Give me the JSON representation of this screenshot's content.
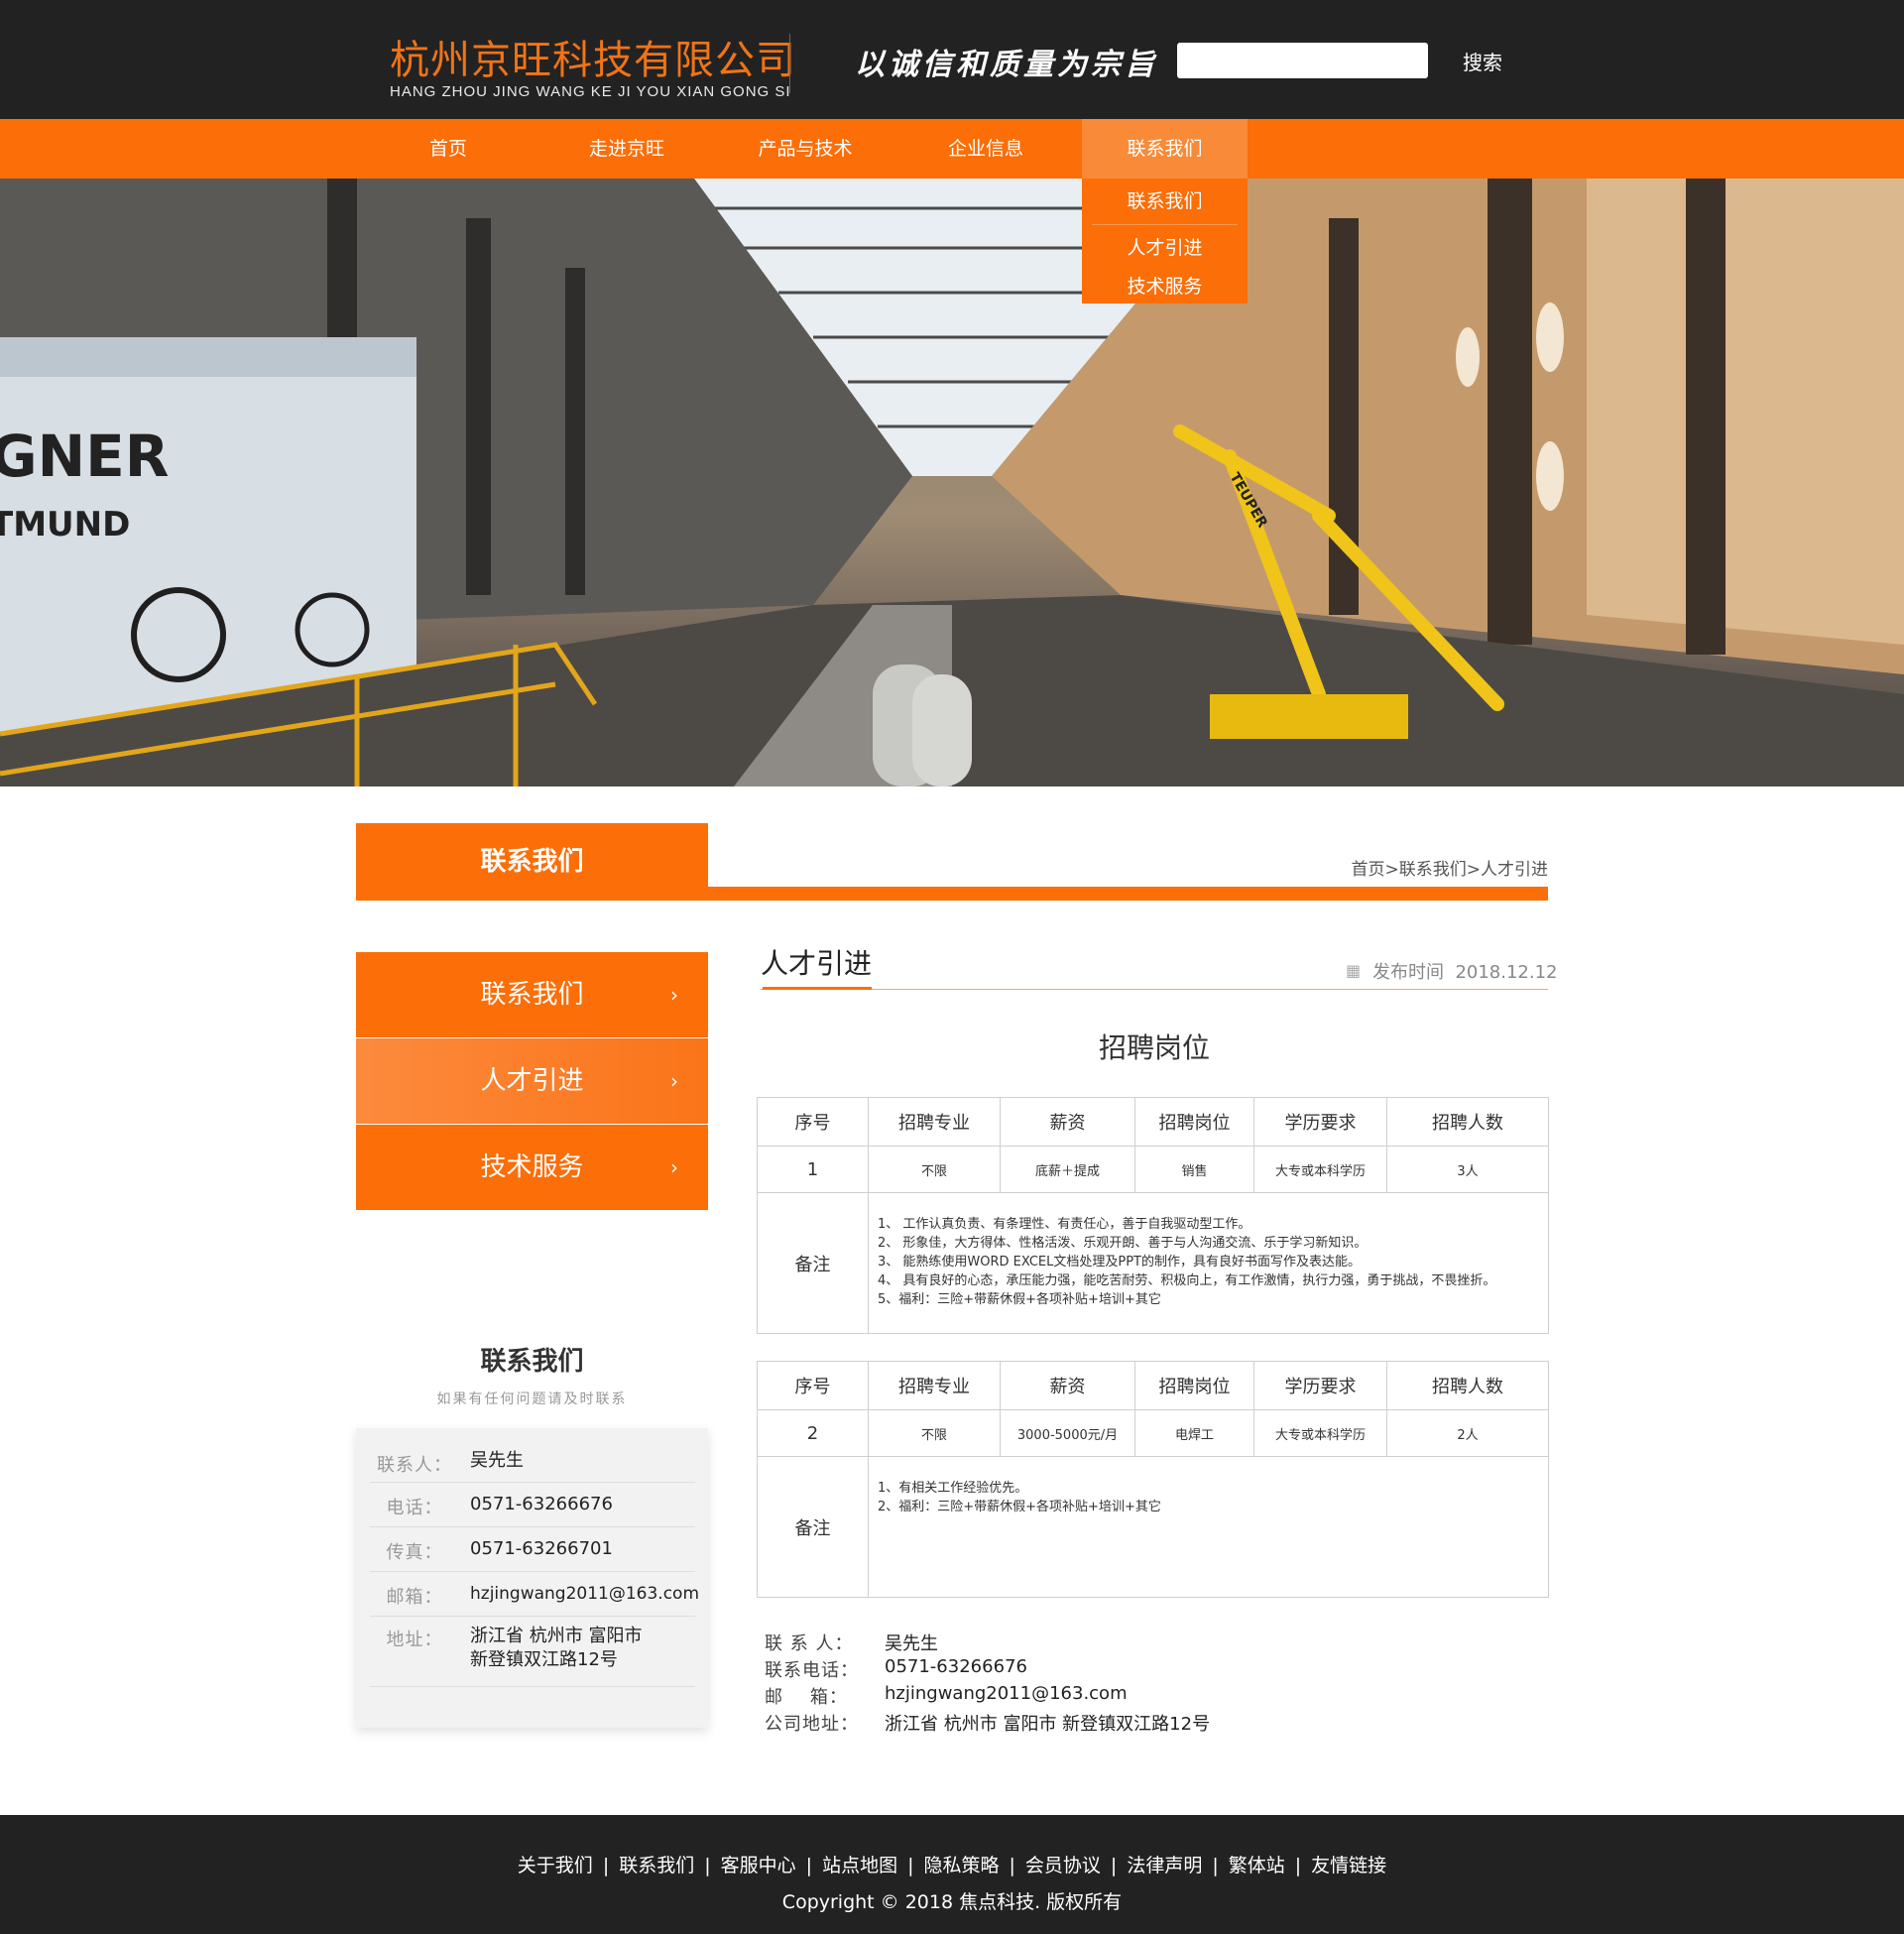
{
  "header": {
    "company_name": "杭州京旺科技有限公司",
    "company_pinyin": "HANG ZHOU JING WANG KE JI YOU XIAN GONG SI",
    "slogan": "以诚信和质量为宗旨",
    "search_placeholder": "",
    "search_label": "搜索"
  },
  "nav": {
    "items": [
      "首页",
      "走进京旺",
      "产品与技术",
      "企业信息",
      "联系我们"
    ],
    "dropdown": [
      "联系我们",
      "人才引进",
      "技术服务"
    ]
  },
  "banner": {
    "text_line1": "GNER",
    "text_line2": "TMUND",
    "crane_label": "TEUPER",
    "active_slide": 1,
    "slide_count": 2
  },
  "section": {
    "title": "联系我们",
    "breadcrumb": [
      "首页",
      "联系我们",
      "人才引进"
    ],
    "breadcrumb_sep": ">"
  },
  "sidebar": {
    "menu": [
      "联系我们",
      "人才引进",
      "技术服务"
    ],
    "arrow": "›",
    "contact_title": "联系我们",
    "contact_subtitle": "如果有任何问题请及时联系",
    "contact": [
      {
        "label": "联系人：",
        "value": "吴先生"
      },
      {
        "label": "电话：",
        "value": "0571-63266676"
      },
      {
        "label": "传真：",
        "value": "0571-63266701"
      },
      {
        "label": "邮箱：",
        "value": "hzjingwang2011@163.com"
      },
      {
        "label": "地址：",
        "value_line1": "浙江省 杭州市 富阳市",
        "value_line2": "新登镇双江路12号"
      }
    ]
  },
  "article": {
    "title": "人才引进",
    "date_label": "发布时间",
    "date": "2018.12.12",
    "heading": "招聘岗位",
    "columns": [
      "序号",
      "招聘专业",
      "薪资",
      "招聘岗位",
      "学历要求",
      "招聘人数"
    ],
    "notes_label": "备注",
    "jobs": [
      {
        "no": "1",
        "major": "不限",
        "salary": "底薪＋提成",
        "position": "销售",
        "education": "大专或本科学历",
        "count": "3人",
        "notes": [
          "1、 工作认真负责、有条理性、有责任心，善于自我驱动型工作。",
          "2、 形象佳，大方得体、性格活泼、乐观开朗、善于与人沟通交流、乐于学习新知识。",
          "3、 能熟练使用WORD EXCEL文档处理及PPT的制作，具有良好书面写作及表达能。",
          "4、 具有良好的心态，承压能力强，能吃苦耐劳、积极向上，有工作激情，执行力强，勇于挑战，不畏挫折。",
          "5、福利：三险+带薪休假+各项补贴+培训+其它"
        ]
      },
      {
        "no": "2",
        "major": "不限",
        "salary": "3000-5000元/月",
        "position": "电焊工",
        "education": "大专或本科学历",
        "count": "2人",
        "notes": [
          "1、有相关工作经验优先。",
          "2、福利：三险+带薪休假+各项补贴+培训+其它"
        ]
      }
    ],
    "contact": [
      {
        "label": "联 系 人：",
        "value": "吴先生"
      },
      {
        "label": "联系电话：",
        "value": "0571-63266676"
      },
      {
        "label": "邮    箱：",
        "value": "hzjingwang2011@163.com"
      },
      {
        "label": "公司地址：",
        "value": "浙江省 杭州市 富阳市 新登镇双江路12号"
      }
    ]
  },
  "footer": {
    "links": [
      "关于我们",
      "联系我们",
      "客服中心",
      "站点地图",
      "隐私策略",
      "会员协议",
      "法律声明",
      "繁体站",
      "友情链接"
    ],
    "link_sep": "|",
    "copyright": "Copyright © 2018 焦点科技. 版权所有"
  },
  "colors": {
    "accent": "#fb6e08",
    "header_bg": "#222222",
    "logo_text": "#f07418"
  }
}
